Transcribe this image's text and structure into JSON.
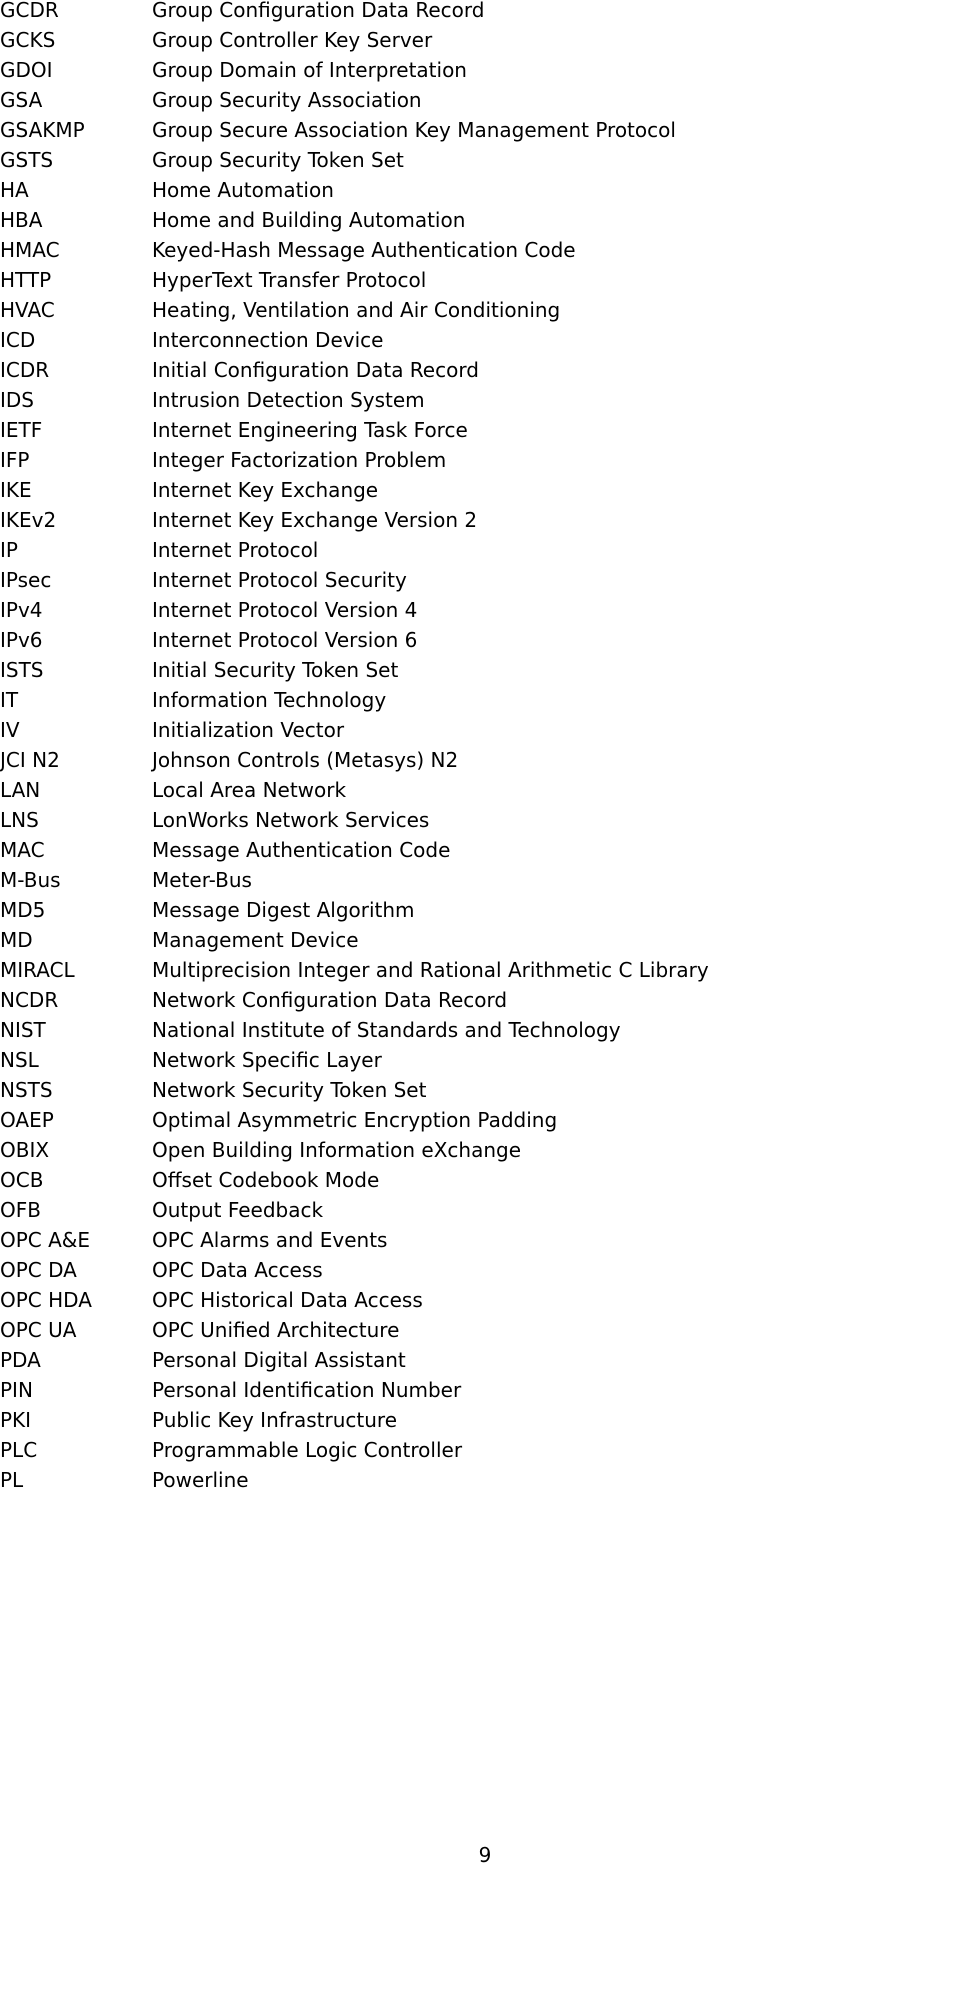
{
  "abbreviations": [
    {
      "abbr": "GCDR",
      "def": "Group Configuration Data Record"
    },
    {
      "abbr": "GCKS",
      "def": "Group Controller Key Server"
    },
    {
      "abbr": "GDOI",
      "def": "Group Domain of Interpretation"
    },
    {
      "abbr": "GSA",
      "def": "Group Security Association"
    },
    {
      "abbr": "GSAKMP",
      "def": "Group Secure Association Key Management Protocol"
    },
    {
      "abbr": "GSTS",
      "def": "Group Security Token Set"
    },
    {
      "abbr": "HA",
      "def": "Home Automation"
    },
    {
      "abbr": "HBA",
      "def": "Home and Building Automation"
    },
    {
      "abbr": "HMAC",
      "def": "Keyed-Hash Message Authentication Code"
    },
    {
      "abbr": "HTTP",
      "def": "HyperText Transfer Protocol"
    },
    {
      "abbr": "HVAC",
      "def": "Heating, Ventilation and Air Conditioning"
    },
    {
      "abbr": "ICD",
      "def": "Interconnection Device"
    },
    {
      "abbr": "ICDR",
      "def": "Initial Configuration Data Record"
    },
    {
      "abbr": "IDS",
      "def": "Intrusion Detection System"
    },
    {
      "abbr": "IETF",
      "def": "Internet Engineering Task Force"
    },
    {
      "abbr": "IFP",
      "def": "Integer Factorization Problem"
    },
    {
      "abbr": "IKE",
      "def": "Internet Key Exchange"
    },
    {
      "abbr": "IKEv2",
      "def": "Internet Key Exchange Version 2"
    },
    {
      "abbr": "IP",
      "def": "Internet Protocol"
    },
    {
      "abbr": "IPsec",
      "def": "Internet Protocol Security"
    },
    {
      "abbr": "IPv4",
      "def": "Internet Protocol Version 4"
    },
    {
      "abbr": "IPv6",
      "def": "Internet Protocol Version 6"
    },
    {
      "abbr": "ISTS",
      "def": "Initial Security Token Set"
    },
    {
      "abbr": "IT",
      "def": "Information Technology"
    },
    {
      "abbr": "IV",
      "def": "Initialization Vector"
    },
    {
      "abbr": "JCI N2",
      "def": "Johnson Controls (Metasys) N2"
    },
    {
      "abbr": "LAN",
      "def": "Local Area Network"
    },
    {
      "abbr": "LNS",
      "def": "LonWorks Network Services"
    },
    {
      "abbr": "MAC",
      "def": "Message Authentication Code"
    },
    {
      "abbr": "M-Bus",
      "def": "Meter-Bus"
    },
    {
      "abbr": "MD5",
      "def": "Message Digest Algorithm"
    },
    {
      "abbr": "MD",
      "def": "Management Device"
    },
    {
      "abbr": "MIRACL",
      "def": "Multiprecision Integer and Rational Arithmetic C Library"
    },
    {
      "abbr": "NCDR",
      "def": "Network Configuration Data Record"
    },
    {
      "abbr": "NIST",
      "def": "National Institute of Standards and Technology"
    },
    {
      "abbr": "NSL",
      "def": "Network Specific Layer"
    },
    {
      "abbr": "NSTS",
      "def": "Network Security Token Set"
    },
    {
      "abbr": "OAEP",
      "def": "Optimal Asymmetric Encryption Padding"
    },
    {
      "abbr": "OBIX",
      "def": "Open Building Information eXchange"
    },
    {
      "abbr": "OCB",
      "def": "Offset Codebook Mode"
    },
    {
      "abbr": "OFB",
      "def": "Output Feedback"
    },
    {
      "abbr": "OPC A&E",
      "def": "OPC Alarms and Events"
    },
    {
      "abbr": "OPC DA",
      "def": "OPC Data Access"
    },
    {
      "abbr": "OPC HDA",
      "def": "OPC Historical Data Access"
    },
    {
      "abbr": "OPC UA",
      "def": "OPC Unified Architecture"
    },
    {
      "abbr": "PDA",
      "def": "Personal Digital Assistant"
    },
    {
      "abbr": "PIN",
      "def": "Personal Identification Number"
    },
    {
      "abbr": "PKI",
      "def": "Public Key Infrastructure"
    },
    {
      "abbr": "PLC",
      "def": "Programmable Logic Controller"
    },
    {
      "abbr": "PL",
      "def": "Powerline"
    }
  ],
  "page_number": "9"
}
